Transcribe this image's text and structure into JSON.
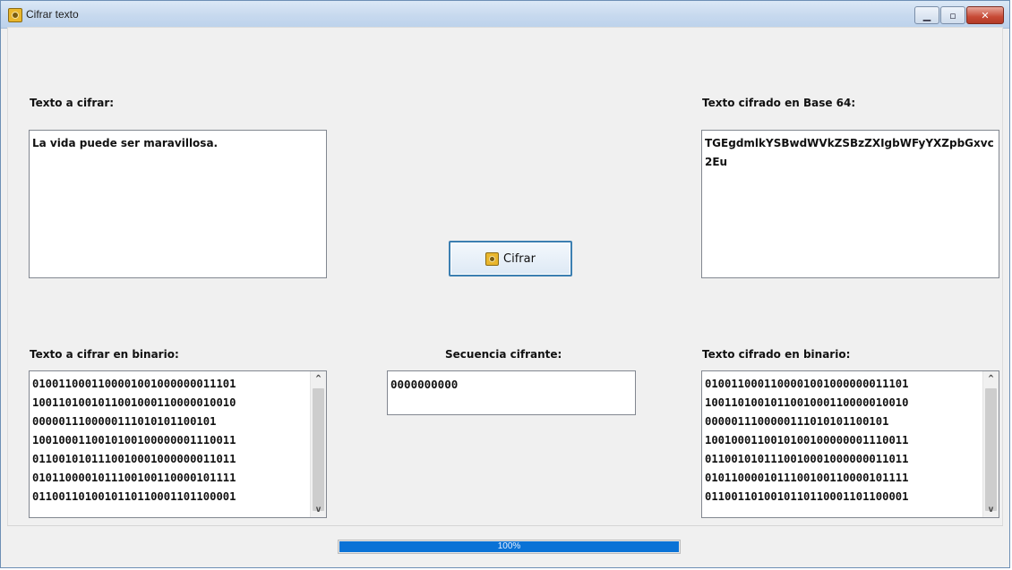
{
  "window": {
    "title": "Cifrar texto",
    "minimize_icon": "minimize-icon",
    "maximize_icon": "maximize-icon",
    "close_icon": "close-icon"
  },
  "labels": {
    "plain": "Texto a cifrar:",
    "cipher_b64": "Texto cifrado en Base 64:",
    "plain_binary": "Texto a cifrar en binario:",
    "key_sequence": "Secuencia cifrante:",
    "cipher_binary": "Texto cifrado en binario:"
  },
  "fields": {
    "plain_text": "La vida puede ser maravillosa.",
    "cipher_b64": "TGEgdmlkYSBwdWVkZSBzZXIgbWFyYXZpbGxvc2Eu",
    "key_sequence": "0000000000"
  },
  "plain_binary_lines": [
    "0100110001100001001000000011101",
    "1001101001011001000110000010010",
    "0000011100000111010101100101",
    "1001000110010100100000001110011",
    "0110010101110010001000000011011",
    "0101100001011100100110000101111",
    "0110011010010110110001101100001"
  ],
  "cipher_binary_lines": [
    "0100110001100001001000000011101",
    "1001101001011001000110000010010",
    "0000011100000111010101100101",
    "1001000110010100100000001110011",
    "0110010101110010001000000011011",
    "0101100001011100100110000101111",
    "0110011010010110110001101100001"
  ],
  "button": {
    "label": "Cifrar",
    "icon": "safe-icon"
  },
  "progress": {
    "value": 1.0,
    "text": "100%"
  },
  "colors": {
    "progress_fill": "#0a72d6",
    "button_border": "#3c7fb1"
  }
}
